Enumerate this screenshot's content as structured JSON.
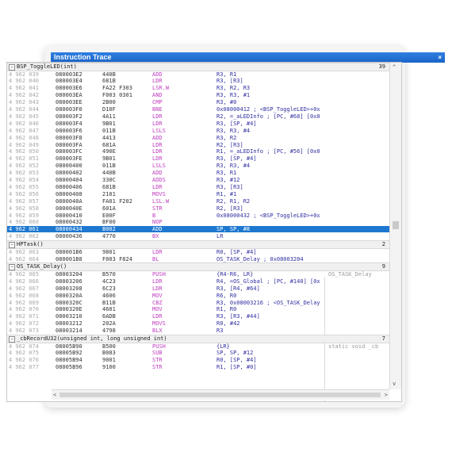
{
  "window": {
    "title": "Instruction Trace",
    "close_label": "×"
  },
  "groups": [
    {
      "name": "BSP_ToggleLED(int)",
      "count": "39",
      "rows": [
        {
          "idx": "4 962 039",
          "addr": "080003E2",
          "op": "440B",
          "mn": "ADD",
          "args": "R3, R1"
        },
        {
          "idx": "4 962 040",
          "addr": "080003E4",
          "op": "681B",
          "mn": "LDR",
          "args": "R3, [R3]"
        },
        {
          "idx": "4 962 041",
          "addr": "080003E6",
          "op": "FA22 F303",
          "mn": "LSR.W",
          "args": "R3, R2, R3"
        },
        {
          "idx": "4 962 042",
          "addr": "080003EA",
          "op": "F003 0301",
          "mn": "AND",
          "args": "R3, R3, #1"
        },
        {
          "idx": "4 962 043",
          "addr": "080003EE",
          "op": "2B00",
          "mn": "CMP",
          "args": "R3, #0"
        },
        {
          "idx": "4 962 044",
          "addr": "080003F0",
          "op": "D10F",
          "mn": "BNE",
          "args": "0x08000412 ; <BSP_ToggleLED>+0x"
        },
        {
          "idx": "4 962 045",
          "addr": "080003F2",
          "op": "4A11",
          "mn": "LDR",
          "args": "R2, =_aLEDInfo ; [PC, #68] [0x0"
        },
        {
          "idx": "4 962 046",
          "addr": "080003F4",
          "op": "9B01",
          "mn": "LDR",
          "args": "R3, [SP, #4]"
        },
        {
          "idx": "4 962 047",
          "addr": "080003F6",
          "op": "011B",
          "mn": "LSLS",
          "args": "R3, R3, #4"
        },
        {
          "idx": "4 962 048",
          "addr": "080003F8",
          "op": "4413",
          "mn": "ADD",
          "args": "R3, R2"
        },
        {
          "idx": "4 962 049",
          "addr": "080003FA",
          "op": "681A",
          "mn": "LDR",
          "args": "R2, [R3]"
        },
        {
          "idx": "4 962 050",
          "addr": "080003FC",
          "op": "490E",
          "mn": "LDR",
          "args": "R1, =_aLEDInfo ; [PC, #56] [0x0"
        },
        {
          "idx": "4 962 051",
          "addr": "080003FE",
          "op": "9B01",
          "mn": "LDR",
          "args": "R3, [SP, #4]"
        },
        {
          "idx": "4 962 052",
          "addr": "08000400",
          "op": "011B",
          "mn": "LSLS",
          "args": "R3, R3, #4"
        },
        {
          "idx": "4 962 053",
          "addr": "08000402",
          "op": "440B",
          "mn": "ADD",
          "args": "R3, R1"
        },
        {
          "idx": "4 962 054",
          "addr": "08000404",
          "op": "330C",
          "mn": "ADDS",
          "args": "R3, #12"
        },
        {
          "idx": "4 962 055",
          "addr": "08000406",
          "op": "681B",
          "mn": "LDR",
          "args": "R3, [R3]"
        },
        {
          "idx": "4 962 056",
          "addr": "08000408",
          "op": "2101",
          "mn": "MOVS",
          "args": "R1, #1"
        },
        {
          "idx": "4 962 057",
          "addr": "0800040A",
          "op": "FA01 F202",
          "mn": "LSL.W",
          "args": "R2, R1, R2"
        },
        {
          "idx": "4 962 058",
          "addr": "0800040E",
          "op": "601A",
          "mn": "STR",
          "args": "R2, [R3]"
        },
        {
          "idx": "4 962 059",
          "addr": "08000410",
          "op": "E00F",
          "mn": "B",
          "args": "0x08000432 ; <BSP_ToggleLED>+0x"
        },
        {
          "idx": "4 962 060",
          "addr": "08000432",
          "op": "BF00",
          "mn": "NOP",
          "args": ""
        },
        {
          "idx": "4 962 061",
          "addr": "08000434",
          "op": "B002",
          "mn": "ADD",
          "args": "SP, SP, #8",
          "selected": true
        },
        {
          "idx": "4 962 062",
          "addr": "08000436",
          "op": "4770",
          "mn": "BX",
          "args": "LR"
        }
      ]
    },
    {
      "name": "HPTask()",
      "count": "2",
      "rows": [
        {
          "idx": "4 962 063",
          "addr": "080001B6",
          "op": "9801",
          "mn": "LDR",
          "args": "R0, [SP, #4]"
        },
        {
          "idx": "4 962 064",
          "addr": "080001B8",
          "op": "F003 F824",
          "mn": "BL",
          "args": "OS_TASK_Delay ; 0x08003204"
        }
      ]
    },
    {
      "name": "OS_TASK_Delay()",
      "count": "9",
      "rows": [
        {
          "idx": "4 962 065",
          "addr": "08003204",
          "op": "B570",
          "mn": "PUSH",
          "args": "{R4-R6, LR}",
          "src": "OS_TASK_Delay"
        },
        {
          "idx": "4 962 066",
          "addr": "08003206",
          "op": "4C23",
          "mn": "LDR",
          "args": "R4, =OS_Global ; [PC, #140] [0x"
        },
        {
          "idx": "4 962 067",
          "addr": "08003208",
          "op": "6C23",
          "mn": "LDR",
          "args": "R3, [R4, #64]"
        },
        {
          "idx": "4 962 068",
          "addr": "0800320A",
          "op": "4606",
          "mn": "MOV",
          "args": "R6, R0"
        },
        {
          "idx": "4 962 069",
          "addr": "0800320C",
          "op": "B11B",
          "mn": "CBZ",
          "args": "R3, 0x08003216 ; <OS_TASK_Delay"
        },
        {
          "idx": "4 962 070",
          "addr": "0800320E",
          "op": "4601",
          "mn": "MOV",
          "args": "R1, R0"
        },
        {
          "idx": "4 962 071",
          "addr": "08003210",
          "op": "6ADB",
          "mn": "LDR",
          "args": "R3, [R3, #44]"
        },
        {
          "idx": "4 962 072",
          "addr": "08003212",
          "op": "202A",
          "mn": "MOVS",
          "args": "R0, #42"
        },
        {
          "idx": "4 962 073",
          "addr": "08003214",
          "op": "4798",
          "mn": "BLX",
          "args": "R3"
        }
      ]
    },
    {
      "name": "_cbRecordU32(unsigned int, long unsigned int)",
      "count": "7",
      "rows": [
        {
          "idx": "4 962 074",
          "addr": "08005B90",
          "op": "B500",
          "mn": "PUSH",
          "args": "{LR}",
          "src": "static void _cb"
        },
        {
          "idx": "4 962 075",
          "addr": "08005B92",
          "op": "B083",
          "mn": "SUB",
          "args": "SP, SP, #12"
        },
        {
          "idx": "4 962 076",
          "addr": "08005B94",
          "op": "9001",
          "mn": "STR",
          "args": "R0, [SP, #4]"
        },
        {
          "idx": "4 962 077",
          "addr": "08005B96",
          "op": "9100",
          "mn": "STR",
          "args": "R1, [SP, #0]"
        }
      ]
    }
  ],
  "scroll": {
    "up": "^",
    "down": "v",
    "left": "<",
    "right": ">"
  }
}
